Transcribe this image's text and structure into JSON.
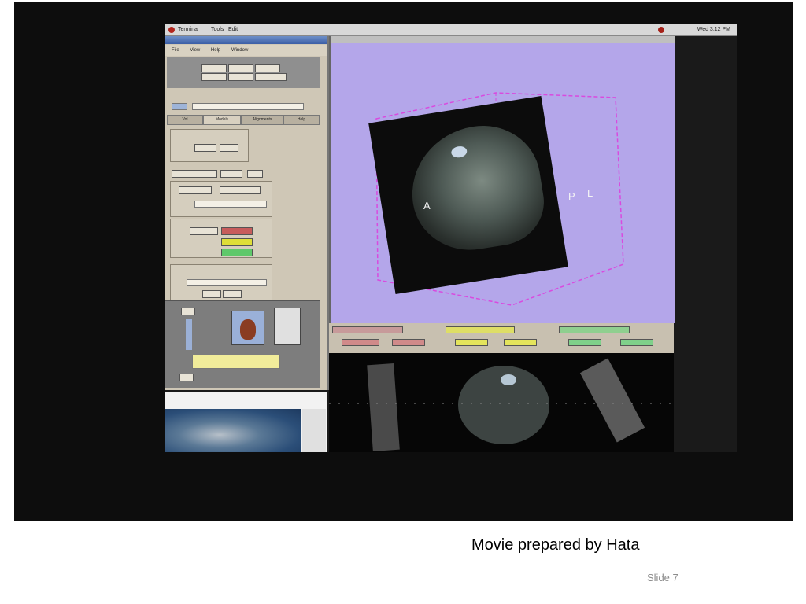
{
  "movie": {
    "menubar": {
      "app_name": "Terminal",
      "menus": [
        "Tools",
        "Edit"
      ],
      "clock": "Wed 3:12 PM"
    },
    "slicer": {
      "panel_menus": [
        "File",
        "View",
        "Help",
        "Window"
      ],
      "tabs": [
        "Vol",
        "Models",
        "Alignments",
        "Help"
      ]
    },
    "view3d": {
      "orientation_labels": [
        "A",
        "P",
        "L"
      ]
    }
  },
  "caption": "Movie prepared by Hata",
  "slide_number": "Slide 7"
}
